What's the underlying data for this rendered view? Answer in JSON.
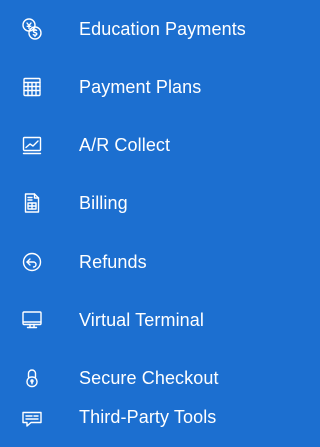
{
  "nav": {
    "items": [
      {
        "label": "Education Payments",
        "icon": "currency-exchange-icon"
      },
      {
        "label": "Payment Plans",
        "icon": "calendar-grid-icon"
      },
      {
        "label": "A/R Collect",
        "icon": "line-chart-icon"
      },
      {
        "label": "Billing",
        "icon": "invoice-icon"
      },
      {
        "label": "Refunds",
        "icon": "refund-arrow-icon"
      },
      {
        "label": "Virtual Terminal",
        "icon": "monitor-icon"
      },
      {
        "label": "Secure Checkout",
        "icon": "padlock-icon"
      },
      {
        "label": "Third-Party Tools",
        "icon": "chat-tools-icon"
      }
    ]
  }
}
